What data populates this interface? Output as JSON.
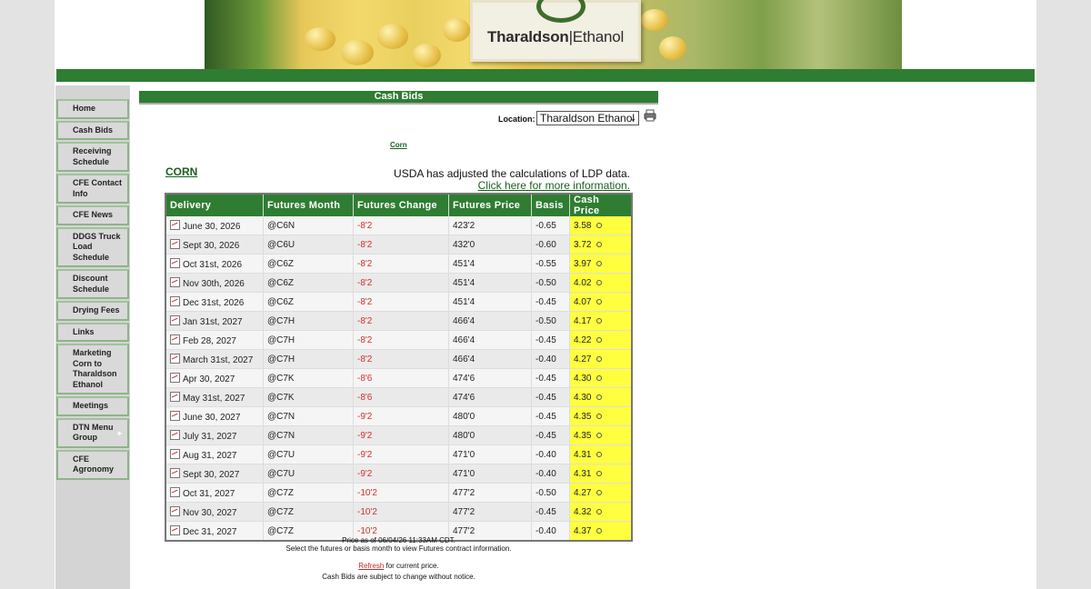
{
  "logo": {
    "name_part1": "Tharaldson",
    "name_part2": "Ethanol"
  },
  "sidebar": {
    "items": [
      {
        "label": "Home"
      },
      {
        "label": "Cash Bids"
      },
      {
        "label": "Receiving Schedule"
      },
      {
        "label": "CFE Contact Info"
      },
      {
        "label": "CFE News"
      },
      {
        "label": "DDGS Truck Load Schedule"
      },
      {
        "label": "Discount Schedule"
      },
      {
        "label": "Drying Fees"
      },
      {
        "label": "Links"
      },
      {
        "label": "Marketing Corn to Tharaldson Ethanol"
      },
      {
        "label": "Meetings"
      },
      {
        "label": "DTN Menu Group"
      },
      {
        "label": "CFE Agronomy"
      }
    ]
  },
  "main": {
    "title": "Cash Bids",
    "location_label": "Location:",
    "location_value": "Tharaldson Ethanol",
    "commodity_link": "Corn",
    "commodity_heading": "CORN",
    "usda_notice": "USDA has adjusted the calculations of LDP data.",
    "usda_link": "Click here for more information.",
    "columns": [
      "Delivery",
      "Futures Month",
      "Futures Change",
      "Futures Price",
      "Basis",
      "Cash Price"
    ],
    "rows": [
      {
        "delivery": "June 30, 2026",
        "month": "@C6N",
        "change": "-8'2",
        "price": "423'2",
        "basis": "-0.65",
        "cash": "3.58"
      },
      {
        "delivery": "Sept 30, 2026",
        "month": "@C6U",
        "change": "-8'2",
        "price": "432'0",
        "basis": "-0.60",
        "cash": "3.72"
      },
      {
        "delivery": "Oct 31st, 2026",
        "month": "@C6Z",
        "change": "-8'2",
        "price": "451'4",
        "basis": "-0.55",
        "cash": "3.97"
      },
      {
        "delivery": "Nov 30th, 2026",
        "month": "@C6Z",
        "change": "-8'2",
        "price": "451'4",
        "basis": "-0.50",
        "cash": "4.02"
      },
      {
        "delivery": "Dec 31st, 2026",
        "month": "@C6Z",
        "change": "-8'2",
        "price": "451'4",
        "basis": "-0.45",
        "cash": "4.07"
      },
      {
        "delivery": "Jan 31st, 2027",
        "month": "@C7H",
        "change": "-8'2",
        "price": "466'4",
        "basis": "-0.50",
        "cash": "4.17"
      },
      {
        "delivery": "Feb 28, 2027",
        "month": "@C7H",
        "change": "-8'2",
        "price": "466'4",
        "basis": "-0.45",
        "cash": "4.22"
      },
      {
        "delivery": "March 31st, 2027",
        "month": "@C7H",
        "change": "-8'2",
        "price": "466'4",
        "basis": "-0.40",
        "cash": "4.27"
      },
      {
        "delivery": "Apr 30, 2027",
        "month": "@C7K",
        "change": "-8'6",
        "price": "474'6",
        "basis": "-0.45",
        "cash": "4.30"
      },
      {
        "delivery": "May 31st, 2027",
        "month": "@C7K",
        "change": "-8'6",
        "price": "474'6",
        "basis": "-0.45",
        "cash": "4.30"
      },
      {
        "delivery": "June 30, 2027",
        "month": "@C7N",
        "change": "-9'2",
        "price": "480'0",
        "basis": "-0.45",
        "cash": "4.35"
      },
      {
        "delivery": "July 31, 2027",
        "month": "@C7N",
        "change": "-9'2",
        "price": "480'0",
        "basis": "-0.45",
        "cash": "4.35"
      },
      {
        "delivery": "Aug 31, 2027",
        "month": "@C7U",
        "change": "-9'2",
        "price": "471'0",
        "basis": "-0.40",
        "cash": "4.31"
      },
      {
        "delivery": "Sept 30, 2027",
        "month": "@C7U",
        "change": "-9'2",
        "price": "471'0",
        "basis": "-0.40",
        "cash": "4.31"
      },
      {
        "delivery": "Oct 31, 2027",
        "month": "@C7Z",
        "change": "-10'2",
        "price": "477'2",
        "basis": "-0.50",
        "cash": "4.27"
      },
      {
        "delivery": "Nov 30, 2027",
        "month": "@C7Z",
        "change": "-10'2",
        "price": "477'2",
        "basis": "-0.45",
        "cash": "4.32"
      },
      {
        "delivery": "Dec 31, 2027",
        "month": "@C7Z",
        "change": "-10'2",
        "price": "477'2",
        "basis": "-0.40",
        "cash": "4.37"
      }
    ],
    "price_as_of": "Price as of 06/04/26 11:33AM CDT.",
    "select_hint": "Select the futures or basis month to view Futures contract information.",
    "refresh_link": "Refresh",
    "refresh_suffix": " for current price.",
    "disclaimer": "Cash Bids are subject to change without notice."
  },
  "colors": {
    "green": "#2e7d32",
    "cash_highlight": "#ffff40",
    "change_red": "#d32f2f"
  }
}
